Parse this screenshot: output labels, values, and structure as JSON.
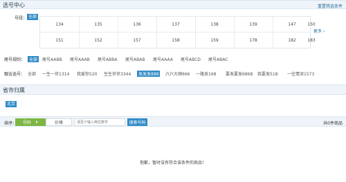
{
  "header": {
    "title": "选号中心",
    "reset_label": "重置筛选条件"
  },
  "number_filter": {
    "label": "号段：",
    "selected": "全部",
    "grid": [
      "134",
      "135",
      "136",
      "137",
      "138",
      "139",
      "147",
      "150",
      "151",
      "152",
      "157",
      "158",
      "159",
      "178",
      "182",
      "183"
    ],
    "more_label": "更多 ›"
  },
  "tail_rule": {
    "label": "尾号规则：",
    "options": [
      "全部",
      "尾号AABB",
      "尾号AAAB",
      "尾号ABBA",
      "尾号ABAB",
      "尾号AAAA",
      "尾号ABCD",
      "尾号ABAC"
    ],
    "selected_index": 0
  },
  "lucky": {
    "label": "靓吉选号：",
    "options": [
      "全部",
      "一生一世1314",
      "我爱你520",
      "生生世世3344",
      "发发发888",
      "六六大顺666",
      "一路发168",
      "要发要发6868",
      "我要发518",
      "一往情深1573"
    ],
    "selected_index": 4
  },
  "province": {
    "title": "省市归属",
    "selected": "北京"
  },
  "sort": {
    "label": "排序：",
    "number_tab": "号码",
    "price_tab": "价格",
    "search_placeholder": "请至少输入两位数字",
    "search_button": "搜索号码",
    "total": "共0件商品"
  },
  "empty_message": "抱歉，暂时没有符合该条件的商品！"
}
